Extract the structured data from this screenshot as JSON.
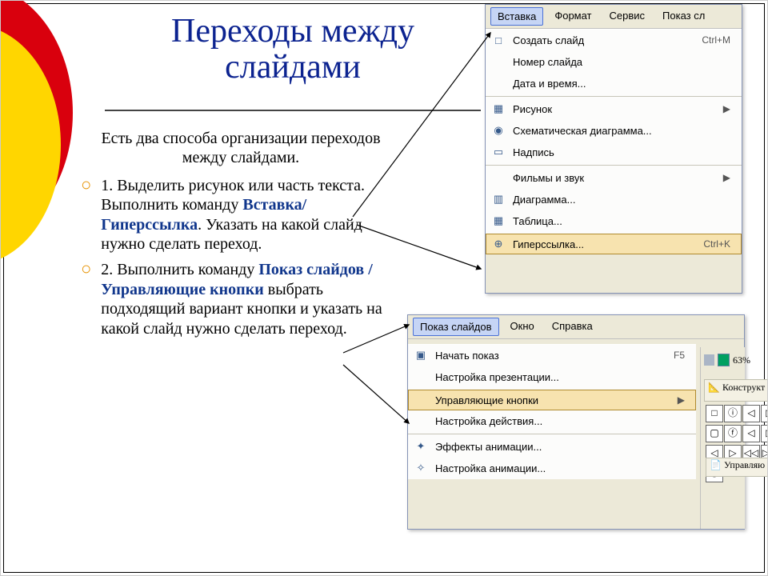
{
  "title": "Переходы между слайдами",
  "lead": "Есть два способа организации переходов между слайдами.",
  "item1": {
    "num": "1. ",
    "a": "Выделить рисунок или часть текста. Выполнить команду ",
    "b": "Вставка/Гиперссылка",
    "c": ". Указать на какой слайд нужно сделать переход."
  },
  "item2": {
    "num": "2. ",
    "a": "Выполнить команду ",
    "b": "Показ слайдов / Управляющие кнопки",
    "c": " выбрать подходящий вариант кнопки и указать на какой слайд нужно сделать переход."
  },
  "insert": {
    "tabs": {
      "active": "Вставка",
      "t2": "Формат",
      "t3": "Сервис",
      "t4": "Показ сл"
    },
    "items": [
      {
        "label": "Создать слайд",
        "shortcut": "Ctrl+M",
        "icon": "□"
      },
      {
        "label": "Номер слайда",
        "icon": " "
      },
      {
        "label": "Дата и время...",
        "icon": " "
      },
      {
        "label": "Рисунок",
        "shortcut": "▶",
        "icon": "▦",
        "sep": true
      },
      {
        "label": "Схематическая диаграмма...",
        "icon": "◉"
      },
      {
        "label": "Надпись",
        "icon": "▭"
      },
      {
        "label": "Фильмы и звук",
        "shortcut": "▶",
        "icon": " ",
        "sep": true
      },
      {
        "label": "Диаграмма...",
        "icon": "▥"
      },
      {
        "label": "Таблица...",
        "icon": "▦"
      },
      {
        "label": "Гиперссылка...",
        "shortcut": "Ctrl+K",
        "icon": "⊕",
        "hover": true,
        "sep": true
      }
    ]
  },
  "show": {
    "tabs": {
      "active": "Показ слайдов",
      "t2": "Окно",
      "t3": "Справка"
    },
    "zoom": "63%",
    "konstr": "Конструкт",
    "upr": "Управляю",
    "items": [
      {
        "label": "Начать показ",
        "shortcut": "F5",
        "icon": "▣"
      },
      {
        "label": "Настройка презентации...",
        "icon": " "
      },
      {
        "label": "Управляющие кнопки",
        "shortcut": "▶",
        "icon": " ",
        "hover": true,
        "sep": true
      },
      {
        "label": "Настройка действия...",
        "icon": " "
      },
      {
        "label": "Эффекты анимации...",
        "icon": "✦",
        "sep": true
      },
      {
        "label": "Настройка анимации...",
        "icon": "✧"
      }
    ],
    "shapes": [
      "□",
      "ⓘ",
      "◁",
      "▷",
      "▢",
      "ⓕ",
      "◁",
      "▷",
      "◁",
      "▷",
      "◁◁",
      "▷▷",
      "ⓢ",
      "",
      "",
      ""
    ]
  }
}
